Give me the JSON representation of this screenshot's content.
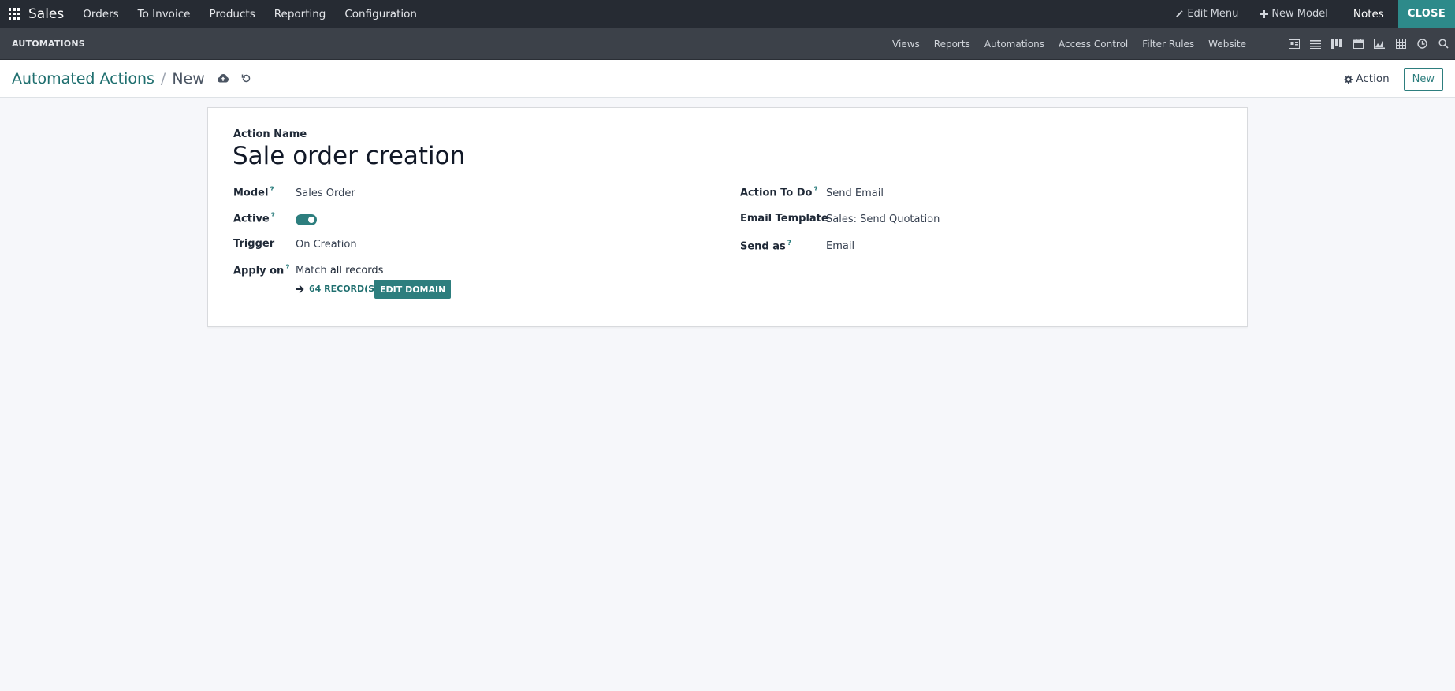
{
  "topbar": {
    "app_name": "Sales",
    "menu": [
      "Orders",
      "To Invoice",
      "Products",
      "Reporting",
      "Configuration"
    ],
    "edit_menu": "Edit Menu",
    "new_model": "New Model",
    "notes": "Notes",
    "close": "CLOSE"
  },
  "studio": {
    "title": "AUTOMATIONS",
    "menu": [
      "Views",
      "Reports",
      "Automations",
      "Access Control",
      "Filter Rules",
      "Website"
    ],
    "view_icons": [
      "form-view-icon",
      "list-view-icon",
      "kanban-view-icon",
      "calendar-view-icon",
      "graph-view-icon",
      "pivot-view-icon",
      "activity-view-icon",
      "search-view-icon"
    ]
  },
  "controlpanel": {
    "breadcrumb_parent": "Automated Actions",
    "breadcrumb_sep": "/",
    "breadcrumb_current": "New",
    "action_label": "Action",
    "new_label": "New"
  },
  "form": {
    "action_name_label": "Action Name",
    "action_name_value": "Sale order creation",
    "model_label": "Model",
    "model_value": "Sales Order",
    "active_label": "Active",
    "active_value": true,
    "trigger_label": "Trigger",
    "trigger_value": "On Creation",
    "apply_on_label": "Apply on",
    "apply_on_prefix": "Match ",
    "apply_on_all": "all records",
    "records_link": "64 RECORD(S)",
    "edit_domain": "EDIT DOMAIN",
    "action_to_do_label": "Action To Do",
    "action_to_do_value": "Send Email",
    "email_template_label": "Email Template",
    "email_template_value": "Sales: Send Quotation",
    "send_as_label": "Send as",
    "send_as_value": "Email",
    "help_mark": "?"
  },
  "colors": {
    "navbar": "#262b33",
    "studiobar": "#3c4149",
    "accent": "#2d7e7e",
    "background": "#f6f7fa"
  }
}
